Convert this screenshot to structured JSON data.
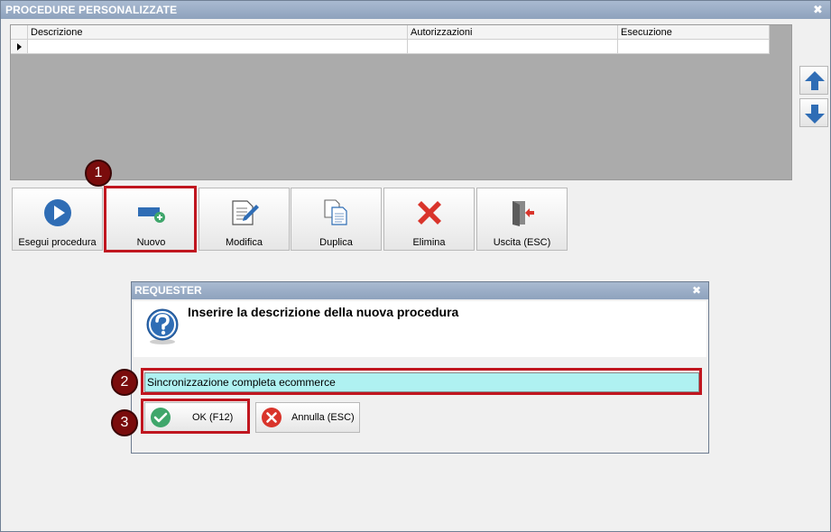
{
  "window": {
    "title": "PROCEDURE PERSONALIZZATE",
    "close_glyph": "✖"
  },
  "grid": {
    "columns": [
      "Descrizione",
      "Autorizzazioni",
      "Esecuzione"
    ],
    "rows": [
      [
        "",
        "",
        ""
      ]
    ]
  },
  "toolbar": {
    "buttons": [
      {
        "label": "Esegui procedura",
        "icon": "play-icon"
      },
      {
        "label": "Nuovo",
        "icon": "new-record-icon"
      },
      {
        "label": "Modifica",
        "icon": "edit-icon"
      },
      {
        "label": "Duplica",
        "icon": "duplicate-icon"
      },
      {
        "label": "Elimina",
        "icon": "delete-icon"
      },
      {
        "label": "Uscita (ESC)",
        "icon": "exit-icon"
      }
    ]
  },
  "side": {
    "up_icon": "arrow-up-icon",
    "down_icon": "arrow-down-icon"
  },
  "callouts": [
    "1",
    "2",
    "3"
  ],
  "dialog": {
    "title": "REQUESTER",
    "close_glyph": "✖",
    "message": "Inserire la descrizione della nuova procedura",
    "input_value": "Sincronizzazione completa ecommerce",
    "ok_label": "OK (F12)",
    "cancel_label": "Annulla (ESC)"
  },
  "colors": {
    "titlebar": "#8ea2bd",
    "highlight": "#c0161f",
    "input_bg": "#aff1f1",
    "accent_blue": "#2f6db5"
  }
}
